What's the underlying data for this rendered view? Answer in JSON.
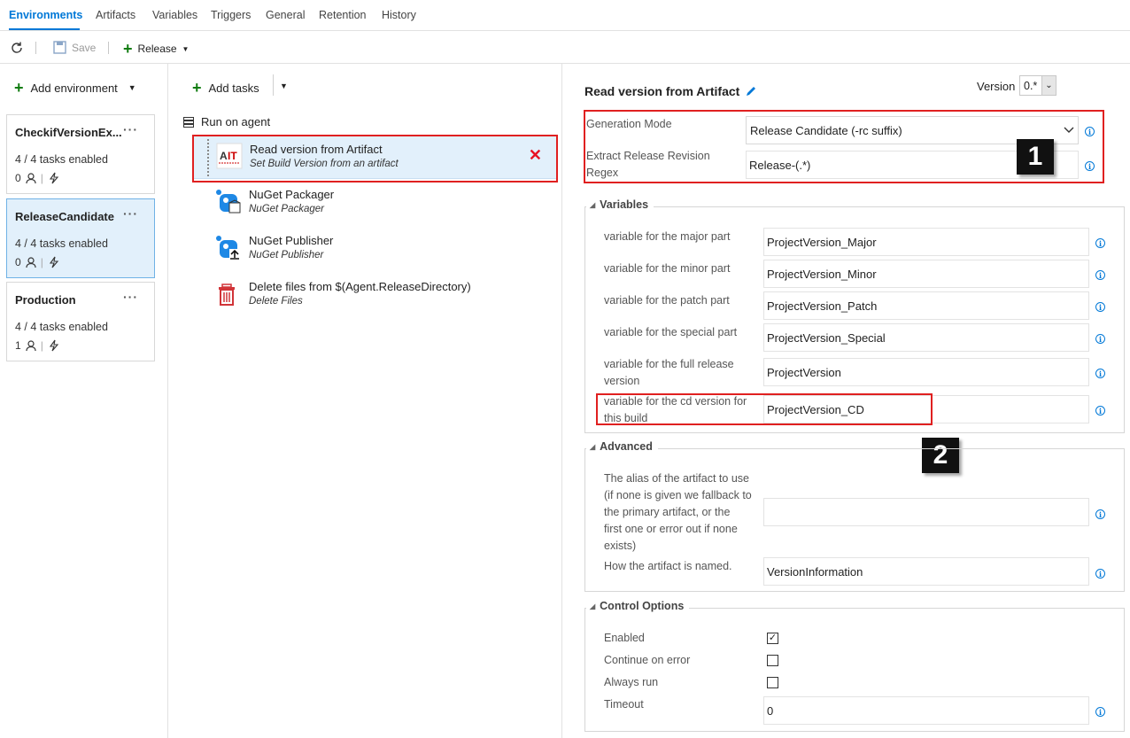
{
  "tabs": [
    "Environments",
    "Artifacts",
    "Variables",
    "Triggers",
    "General",
    "Retention",
    "History"
  ],
  "toolbar": {
    "save_label": "Save",
    "release_label": "Release"
  },
  "environments": {
    "add_label": "Add environment",
    "items": [
      {
        "name": "CheckifVersionEx...",
        "tasks": "4 / 4 tasks enabled",
        "approvers": "0"
      },
      {
        "name": "ReleaseCandidate",
        "tasks": "4 / 4 tasks enabled",
        "approvers": "0"
      },
      {
        "name": "Production",
        "tasks": "4 / 4 tasks enabled",
        "approvers": "1"
      }
    ]
  },
  "tasks": {
    "add_label": "Add tasks",
    "phase_label": "Run on agent",
    "items": [
      {
        "title": "Read version from Artifact",
        "subtitle": "Set Build Version from an artifact",
        "icon": "ait-logo-icon"
      },
      {
        "title": "NuGet Packager",
        "subtitle": "NuGet Packager",
        "icon": "nuget-packager-icon"
      },
      {
        "title": "NuGet Publisher",
        "subtitle": "NuGet Publisher",
        "icon": "nuget-publisher-icon"
      },
      {
        "title": "Delete files from $(Agent.ReleaseDirectory)",
        "subtitle": "Delete Files",
        "icon": "trash-icon"
      }
    ]
  },
  "detail": {
    "title": "Read version from Artifact",
    "version_label": "Version",
    "version_value": "0.*",
    "generation_mode_label": "Generation Mode",
    "generation_mode_value": "Release Candidate (-rc suffix)",
    "regex_label_1": "Extract Release Revision",
    "regex_label_2": "Regex",
    "regex_value": "Release-(.*)",
    "variables": {
      "header": "Variables",
      "major_label": "variable for the major part",
      "major_value": "ProjectVersion_Major",
      "minor_label": "variable for the minor part",
      "minor_value": "ProjectVersion_Minor",
      "patch_label": "variable for the patch part",
      "patch_value": "ProjectVersion_Patch",
      "special_label": "variable for the special part",
      "special_value": "ProjectVersion_Special",
      "full_label_1": "variable for the full release",
      "full_label_2": "version",
      "full_value": "ProjectVersion",
      "cd_label_1": "variable for the cd version for",
      "cd_label_2": "this build",
      "cd_value": "ProjectVersion_CD"
    },
    "advanced": {
      "header": "Advanced",
      "alias_label_1": "The alias of the artifact to use",
      "alias_label_2": "(if none is given we fallback to",
      "alias_label_3": "the primary artifact, or the",
      "alias_label_4": "first one or error out if none",
      "alias_label_5": "exists)",
      "alias_value": "",
      "name_label": "How the artifact is named.",
      "name_value": "VersionInformation"
    },
    "control": {
      "header": "Control Options",
      "enabled_label": "Enabled",
      "enabled": true,
      "continue_label": "Continue on error",
      "continue": false,
      "always_label": "Always run",
      "always": false,
      "timeout_label": "Timeout",
      "timeout_value": "0"
    }
  },
  "callouts": {
    "one": "1",
    "two": "2"
  },
  "colors": {
    "accent": "#0078d7",
    "add_green": "#107c10",
    "remove_red": "#e81123",
    "highlight_box": "#e02020",
    "selected_bg": "#e2f0fb"
  }
}
